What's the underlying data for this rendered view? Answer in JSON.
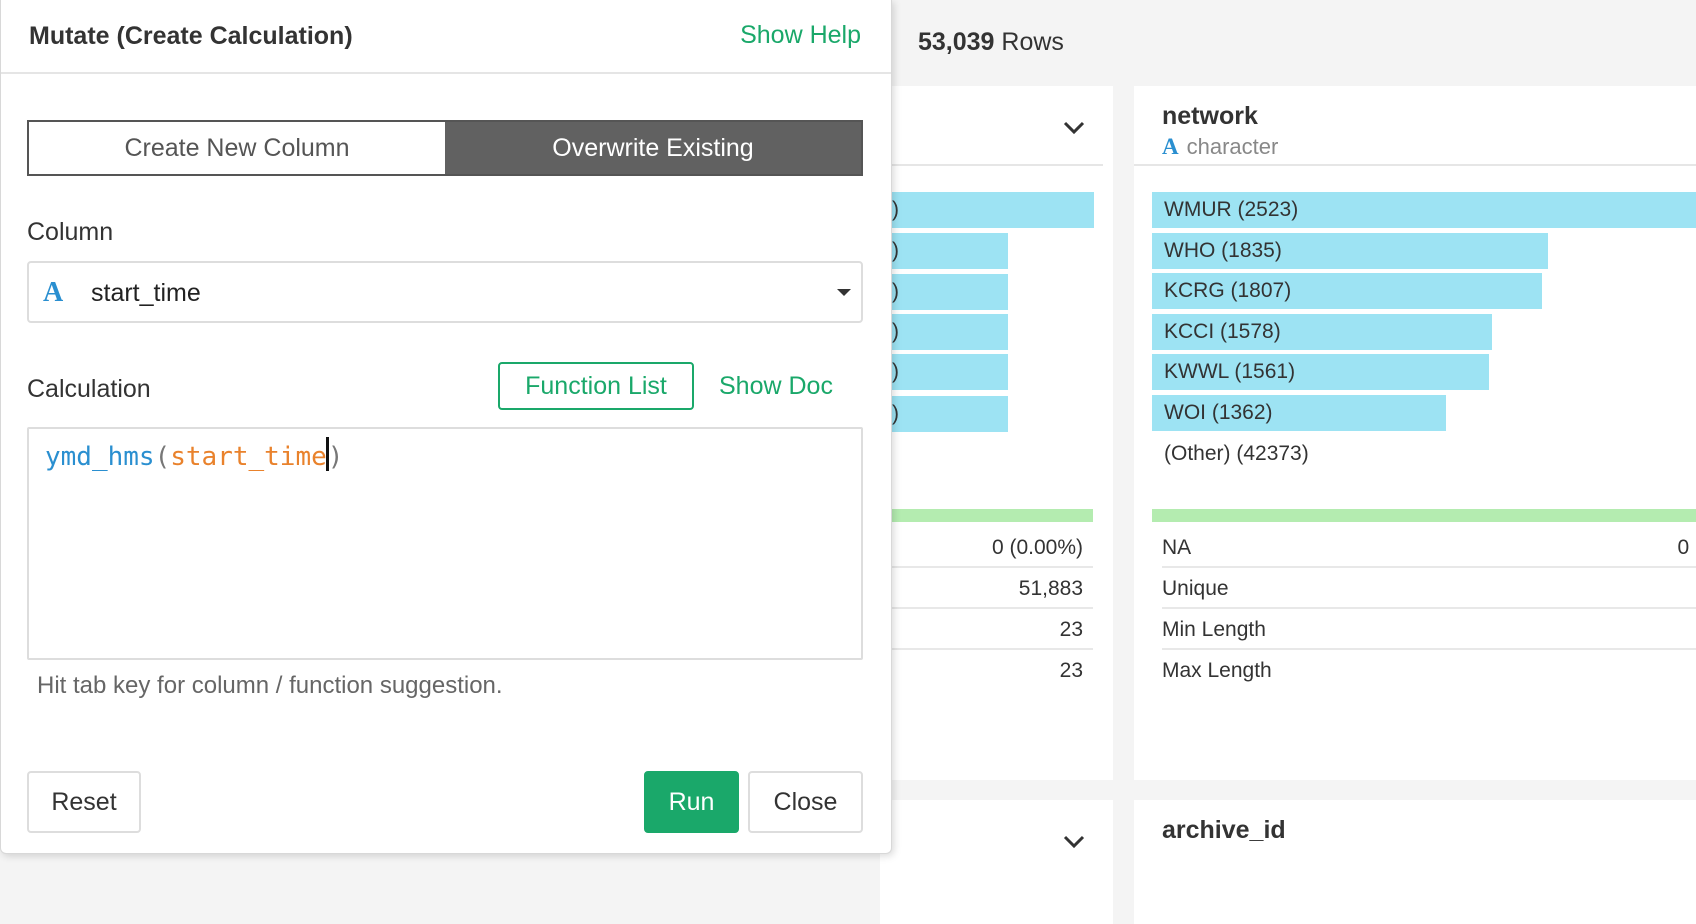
{
  "dialog": {
    "title": "Mutate (Create Calculation)",
    "show_help": "Show Help",
    "tabs": [
      {
        "label": "Create New Column",
        "active": false
      },
      {
        "label": "Overwrite Existing",
        "active": true
      }
    ],
    "column_label": "Column",
    "column_type_icon": "A",
    "column_value": "start_time",
    "calculation_label": "Calculation",
    "function_list_button": "Function List",
    "show_doc": "Show Doc",
    "code": {
      "fn": "ymd_hms",
      "open": "(",
      "arg": "start_time",
      "close": ")"
    },
    "hint": "Hit tab key for column / function suggestion.",
    "reset_button": "Reset",
    "run_button": "Run",
    "close_button": "Close"
  },
  "background": {
    "rows_count": "53,039",
    "rows_label": "Rows",
    "card1": {
      "bar_labels": [
        ")",
        ")",
        ")",
        ")",
        ")",
        ")"
      ],
      "bar_fractions": [
        1.0,
        0.6,
        0.6,
        0.6,
        0.6,
        0.6
      ],
      "stats": [
        "0 (0.00%)",
        "51,883",
        "23",
        "23"
      ]
    },
    "network": {
      "name": "network",
      "type_icon": "A",
      "type": "character",
      "bars": [
        {
          "label": "WMUR (2523)",
          "count": 2523
        },
        {
          "label": "WHO (1835)",
          "count": 1835
        },
        {
          "label": "KCRG (1807)",
          "count": 1807
        },
        {
          "label": "KCCI (1578)",
          "count": 1578
        },
        {
          "label": "KWWL (1561)",
          "count": 1561
        },
        {
          "label": "WOI (1362)",
          "count": 1362
        }
      ],
      "other": "(Other) (42373)",
      "stats": [
        {
          "label": "NA",
          "value": "0 ("
        },
        {
          "label": "Unique",
          "value": ""
        },
        {
          "label": "Min Length",
          "value": ""
        },
        {
          "label": "Max Length",
          "value": ""
        }
      ]
    },
    "archive": {
      "name": "archive_id"
    }
  },
  "colors": {
    "accent": "#1aa86a",
    "bar": "#9de3f3",
    "na_bar": "#b4ecb0",
    "type_icon": "#2a8fd0",
    "arg": "#e9822c"
  }
}
